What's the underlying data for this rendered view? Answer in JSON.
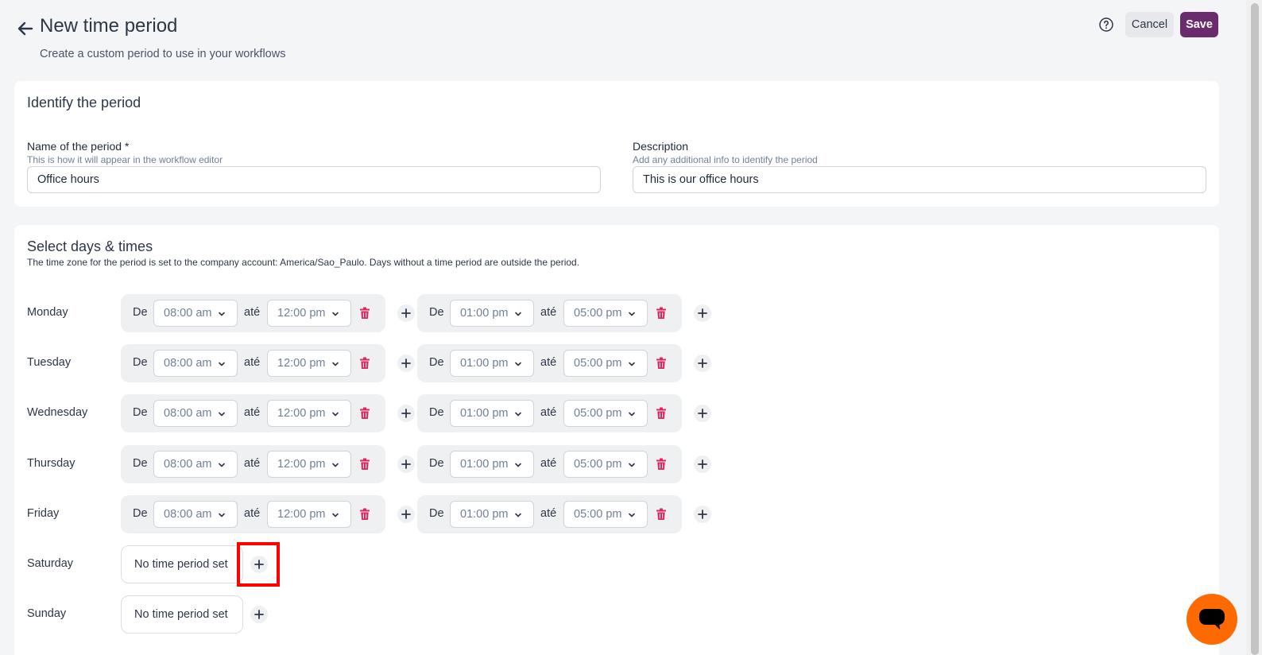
{
  "header": {
    "title": "New time period",
    "subtitle": "Create a custom period to use in your workflows",
    "cancel_label": "Cancel",
    "save_label": "Save"
  },
  "identify": {
    "title": "Identify the period",
    "name_label": "Name of the period *",
    "name_help": "This is how it will appear in the workflow editor",
    "name_value": "Office hours",
    "description_label": "Description",
    "description_help": "Add any additional info to identify the period",
    "description_value": "This is our office hours"
  },
  "days": {
    "title": "Select days & times",
    "timezone_note": "The time zone for the period is set to the company account: America/Sao_Paulo. Days without a time period are outside the period.",
    "from_label": "De",
    "to_label": "até",
    "empty_label": "No time period set",
    "rows": [
      {
        "day": "Monday",
        "slots": [
          {
            "from": "08:00 am",
            "to": "12:00 pm"
          },
          {
            "from": "01:00 pm",
            "to": "05:00 pm"
          }
        ]
      },
      {
        "day": "Tuesday",
        "slots": [
          {
            "from": "08:00 am",
            "to": "12:00 pm"
          },
          {
            "from": "01:00 pm",
            "to": "05:00 pm"
          }
        ]
      },
      {
        "day": "Wednesday",
        "slots": [
          {
            "from": "08:00 am",
            "to": "12:00 pm"
          },
          {
            "from": "01:00 pm",
            "to": "05:00 pm"
          }
        ]
      },
      {
        "day": "Thursday",
        "slots": [
          {
            "from": "08:00 am",
            "to": "12:00 pm"
          },
          {
            "from": "01:00 pm",
            "to": "05:00 pm"
          }
        ]
      },
      {
        "day": "Friday",
        "slots": [
          {
            "from": "08:00 am",
            "to": "12:00 pm"
          },
          {
            "from": "01:00 pm",
            "to": "05:00 pm"
          }
        ]
      },
      {
        "day": "Saturday",
        "slots": []
      },
      {
        "day": "Sunday",
        "slots": []
      }
    ]
  },
  "icons": {
    "back": "arrow-left-icon",
    "help": "question-circle-icon",
    "chevron": "chevron-down-icon",
    "trash": "trash-icon",
    "plus": "plus-icon",
    "chat": "chat-icon"
  },
  "colors": {
    "primary": "#6b2c6e",
    "danger": "#e0245e",
    "chat": "#ff6a00",
    "highlight": "#ff0000"
  }
}
